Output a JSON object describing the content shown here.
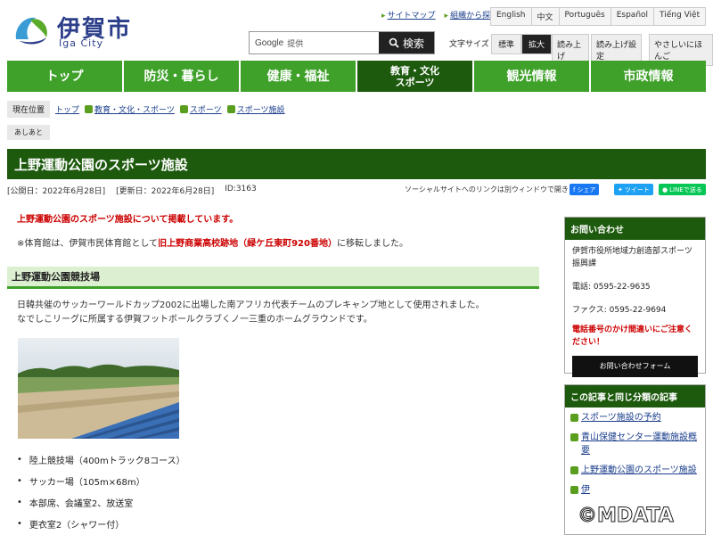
{
  "site": {
    "logo_text": "伊賀市",
    "logo_sub": "Iga City",
    "util_links": [
      "サイトマップ",
      "組織から探す"
    ],
    "languages": [
      "English",
      "中文",
      "Português",
      "Español",
      "Tiếng Việt"
    ],
    "search_brand": "Google",
    "search_powered": "提供",
    "search_button": "検索",
    "text_size_label": "文字サイズ",
    "text_size_options": [
      "標準",
      "拡大"
    ],
    "tools": [
      "読み上げ",
      "読み上げ設定",
      "やさしいにほんご"
    ]
  },
  "nav": [
    "トップ",
    "防災・暮らし",
    "健康・福祉",
    "教育・文化\nスポーツ",
    "観光情報",
    "市政情報"
  ],
  "breadcrumb": {
    "label": "現在位置",
    "items": [
      "トップ",
      "教育・文化・スポーツ",
      "スポーツ",
      "スポーツ施設"
    ]
  },
  "ashiato": "あしあと",
  "page": {
    "title": "上野運動公園のスポーツ施設",
    "published": "[公開日：2022年6月28日]",
    "updated": "[更新日：2022年6月28日]",
    "id": "ID:3163",
    "social_note": "ソーシャルサイトへのリンクは別ウィンドウで開きます",
    "share_fb": "シェア",
    "share_tw": "ツイート",
    "share_line": "LINEで送る",
    "notice": "上野運動公園のスポーツ施設について掲載しています。",
    "moved_prefix": "※体育館は、伊賀市民体育館として",
    "moved_place": "旧上野商業高校跡地（緑ケ丘東町920番地）",
    "moved_suffix": "に移転しました。",
    "section_title": "上野運動公園競技場",
    "desc_1": "日韓共催のサッカーワールドカップ2002に出場した南アフリカ代表チームのプレキャンプ地として使用されました。",
    "desc_2": "なでしこリーグに所属する伊賀フットボールクラブくノ一三重のホームグラウンドです。",
    "facilities": [
      "陸上競技場（400mトラック8コース）",
      "サッカー場（105m×68m）",
      "本部席、会議室2、放送室",
      "更衣室2（シャワー付）"
    ]
  },
  "contact": {
    "heading": "お問い合わせ",
    "dept": "伊賀市役所地域力創造部スポーツ振興課",
    "tel": "電話: 0595-22-9635",
    "fax": "ファクス: 0595-22-9694",
    "warning": "電話番号のかけ間違いにご注意ください！",
    "form_button": "お問い合わせフォーム"
  },
  "related": {
    "heading": "この記事と同じ分類の記事",
    "items": [
      "スポーツ施設の予約",
      "青山保健センター運動施設概要",
      "上野運動公園のスポーツ施設",
      "伊"
    ]
  },
  "watermark": "©MDATA"
}
